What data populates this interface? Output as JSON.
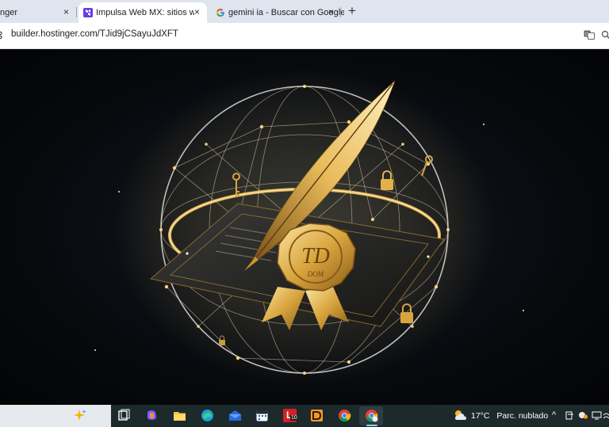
{
  "browser": {
    "tabs": [
      {
        "title": "nger",
        "active": false
      },
      {
        "title": "Impulsa Web MX: sitios web q",
        "active": true
      },
      {
        "title": "gemini ia - Buscar con Google",
        "active": false
      }
    ],
    "tab_close_glyph": "×",
    "new_tab_glyph": "+",
    "url": "builder.hostinger.com/TJid9jCSayuJdXFT"
  },
  "artwork": {
    "seal_text_large": "TD",
    "seal_text_small": "DOM"
  },
  "taskbar": {
    "icons": [
      "copilot-sparkle-icon",
      "task-view-icon",
      "copilot-icon",
      "file-explorer-icon",
      "edge-icon",
      "mail-icon",
      "calendar-icon",
      "app-l-icon",
      "app-d-icon",
      "chrome-icon",
      "chrome-profile-icon"
    ],
    "app_l_label": "L",
    "app_l_badge": "10",
    "weather": {
      "temperature": "17°C",
      "condition": "Parc. nublado"
    },
    "tray_chevron": "^"
  },
  "colors": {
    "tabbar_bg": "#dfe5ef",
    "taskbar_bg": "#1d2a2c",
    "gold": "#e3b34a"
  }
}
